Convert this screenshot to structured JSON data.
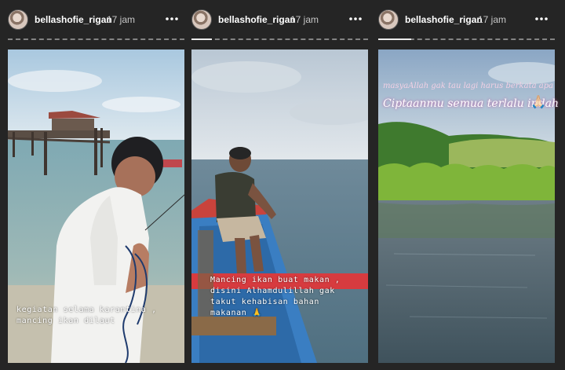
{
  "stories": [
    {
      "username": "bellashofie_rigan",
      "time": "17 jam",
      "caption": "kegiatan selama karantina ,\nmancing ikan dilaut",
      "scene": "pier-fishing"
    },
    {
      "username": "bellashofie_rigan",
      "time": "17 jam",
      "caption": "Mancing ikan buat makan ,\ndisini Alhamdulillah gak\ntakut kehabisan bahan\nmakanan 🙏",
      "scene": "boat"
    },
    {
      "username": "bellashofie_rigan",
      "time": "17 jam",
      "caption_line1": "masyaAllah gak tau lagi harus berkata apa",
      "caption_line2": "Ciptaanmu semua terlalu indah",
      "emoji": "🙏🏻",
      "scene": "mangrove"
    }
  ],
  "icons": {
    "more": "more-horizontal-icon",
    "avatar": "avatar"
  },
  "colors": {
    "background": "#252525",
    "text": "#ffffff",
    "muted": "#c8c8c8",
    "highlight": "#e03342"
  }
}
